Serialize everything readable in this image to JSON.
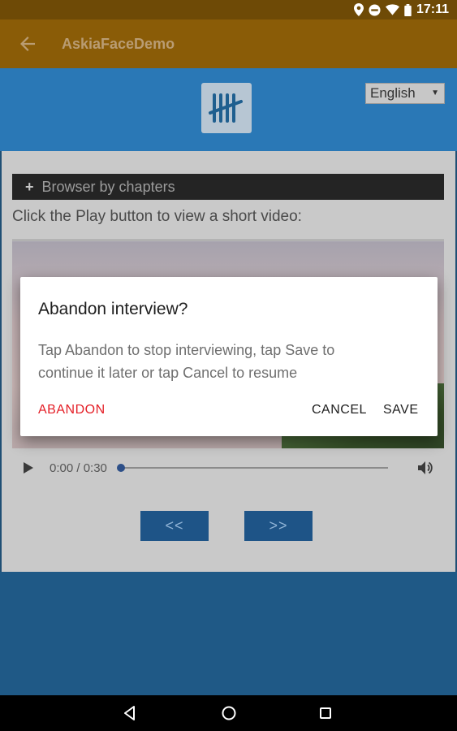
{
  "status_bar": {
    "time": "17:11",
    "icons": [
      "location-icon",
      "do-not-disturb-icon",
      "wifi-icon",
      "battery-icon"
    ]
  },
  "app_bar": {
    "title": "AskiaFaceDemo",
    "back_icon": "arrow-back-icon"
  },
  "page": {
    "logo_icon": "tally-marks-icon",
    "language": {
      "selected": "English"
    },
    "chapters_label": "Browser by chapters",
    "instruction": "Click the Play button to view a short video:",
    "player": {
      "time": "0:00 / 0:30"
    },
    "prev_label": "<<",
    "next_label": ">>"
  },
  "dialog": {
    "title": "Abandon interview?",
    "message": "Tap Abandon to stop interviewing, tap Save to continue it later or tap Cancel to resume",
    "abandon_label": "ABANDON",
    "cancel_label": "CANCEL",
    "save_label": "SAVE"
  },
  "colors": {
    "app_bar": "#8a5c07",
    "status_bar": "#6e4a06",
    "abandon": "#e41e26",
    "nav_button": "#1e5487"
  }
}
